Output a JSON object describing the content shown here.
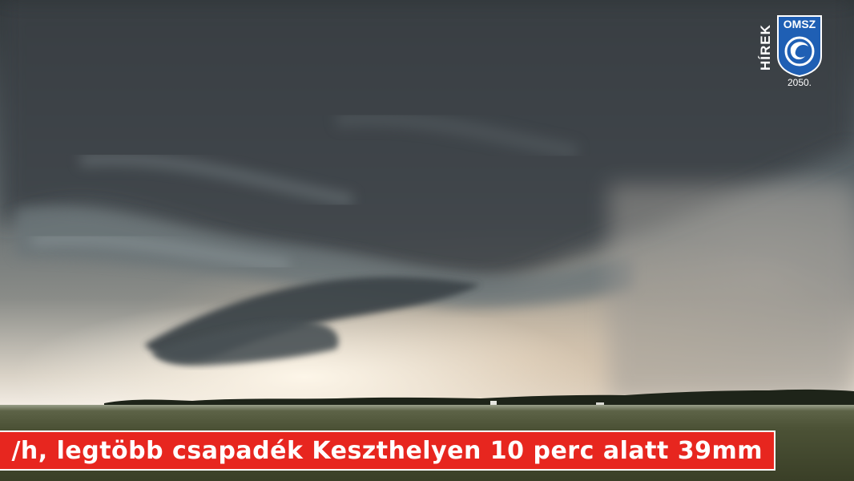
{
  "logo": {
    "side_text": "HÍREK",
    "title": "OMSZ",
    "year": "2050."
  },
  "ticker": {
    "text": "/h, legtöbb csapadék Keszthelyen 10 perc alatt 39mm"
  },
  "colors": {
    "ticker_bg": "#e7261f",
    "logo_blue": "#1f5fb4"
  },
  "scene": {
    "description_icon": "storm-cloud-landscape"
  }
}
